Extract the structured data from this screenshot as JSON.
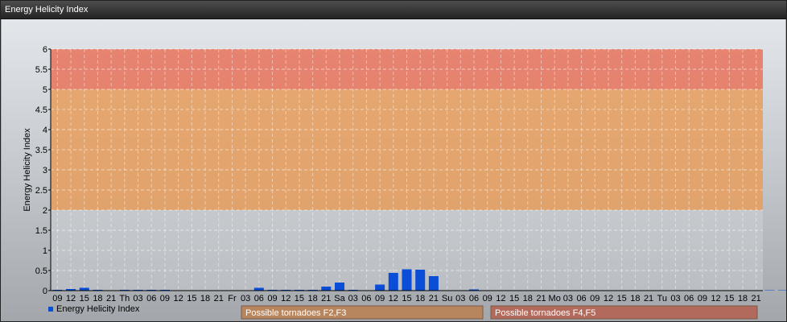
{
  "window": {
    "title": "Energy Helicity Index"
  },
  "colors": {
    "series": "#0a4ed8",
    "band_low": "#d9dcdf",
    "band_mid": "#e89d5c",
    "band_high": "#e8735c",
    "legend_f23": "#b8865e",
    "legend_f45": "#b26a5c"
  },
  "chart_data": {
    "type": "bar",
    "title": "",
    "xlabel": "",
    "ylabel": "Energy Helicity Index",
    "ylim": [
      0,
      6
    ],
    "yticks": [
      "0",
      "0.5",
      "1",
      "1.5",
      "2",
      "2.5",
      "3",
      "3.5",
      "4",
      "4.5",
      "5",
      "5.5",
      "6"
    ],
    "grid": true,
    "legend_placement": "bottom-left",
    "categories": [
      "09",
      "12",
      "15",
      "18",
      "21",
      "Th",
      "03",
      "06",
      "09",
      "12",
      "15",
      "18",
      "21",
      "Fr",
      "03",
      "06",
      "09",
      "12",
      "15",
      "18",
      "21",
      "Sa",
      "03",
      "06",
      "09",
      "12",
      "15",
      "18",
      "21",
      "Su",
      "03",
      "06",
      "09",
      "12",
      "15",
      "18",
      "21",
      "Mo",
      "03",
      "06",
      "09",
      "12",
      "15",
      "18",
      "21",
      "Tu",
      "03",
      "06",
      "09",
      "12",
      "15",
      "18",
      "21"
    ],
    "series": [
      {
        "name": "Energy Helicity Index",
        "values": [
          0.02,
          0.04,
          0.07,
          0.02,
          0.01,
          0.02,
          0.02,
          0.02,
          0.02,
          0.01,
          0.01,
          0.01,
          0.01,
          0.01,
          0.01,
          0.07,
          0.02,
          0.02,
          0.02,
          0.02,
          0.1,
          0.2,
          0.02,
          0.01,
          0.15,
          0.44,
          0.53,
          0.52,
          0.36,
          0.01,
          0.01,
          0.03,
          0.01,
          0.01,
          0.01,
          0.01,
          0.01,
          0.01,
          0.01,
          0.01,
          0.01,
          0.01,
          0.01,
          0.01,
          0.01,
          0.01,
          0.01,
          0.01,
          0.01,
          0.01,
          0.01,
          0.01,
          0.01,
          0.01,
          0.01,
          0.01
        ]
      }
    ],
    "bands": [
      {
        "from": 0,
        "to": 2,
        "label": ""
      },
      {
        "from": 2,
        "to": 5,
        "label": "Possible tornadoes F2,F3"
      },
      {
        "from": 5,
        "to": 6,
        "label": "Possible tornadoes F4,F5"
      }
    ]
  }
}
